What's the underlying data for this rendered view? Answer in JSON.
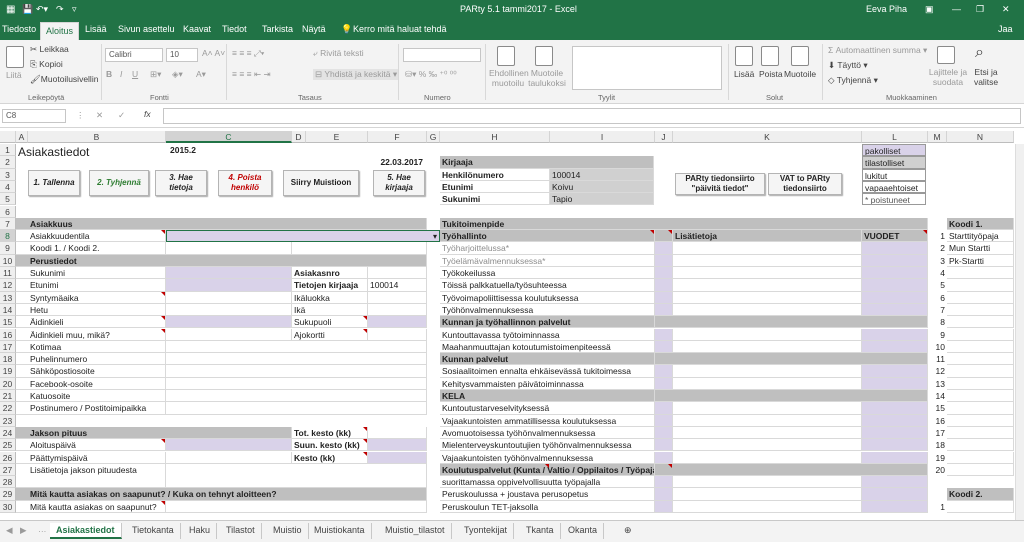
{
  "window": {
    "title": "PARty 5.1 tammi2017  -  Excel",
    "user": "Eeva Piha"
  },
  "menu": {
    "tabs": [
      "Tiedosto",
      "Aloitus",
      "Lisää",
      "Sivun asettelu",
      "Kaavat",
      "Tiedot",
      "Tarkista",
      "Näytä"
    ],
    "tell": "Kerro mitä haluat tehdä",
    "share": "Jaa"
  },
  "ribbon": {
    "paste": "Liitä",
    "cut": "Leikkaa",
    "copy": "Kopioi",
    "format_painter": "Muotoilusivellin",
    "clipboard": "Leikepöytä",
    "font_name": "Calibri",
    "font_size": "10",
    "font": "Fontti",
    "wrap": "Rivitä teksti",
    "merge": "Yhdistä ja keskitä",
    "alignment": "Tasaus",
    "number": "Numero",
    "cond_format": "Ehdollinen muotoilu",
    "table_format": "Muotoile taulukoksi",
    "styles": "Tyylit",
    "insert": "Lisää",
    "delete": "Poista",
    "format": "Muotoile",
    "cells": "Solut",
    "autosum": "Automaattinen summa",
    "fill": "Täyttö",
    "clear": "Tyhjennä",
    "sort": "Lajittele ja suodata",
    "find": "Etsi ja valitse",
    "editing": "Muokkaaminen"
  },
  "formula_bar": {
    "name_box": "C8",
    "fx": "fx",
    "value": ""
  },
  "columns": [
    "A",
    "B",
    "C",
    "D",
    "E",
    "F",
    "G",
    "H",
    "I",
    "J",
    "K",
    "L",
    "M",
    "N"
  ],
  "rows": [
    "1",
    "2",
    "3",
    "4",
    "5",
    "6",
    "7",
    "8",
    "9",
    "10",
    "11",
    "12",
    "13",
    "14",
    "15",
    "16",
    "17",
    "18",
    "19",
    "20",
    "21",
    "22",
    "23",
    "24",
    "25",
    "26",
    "27",
    "28",
    "29",
    "30"
  ],
  "sheet": {
    "title": "Asiakastiedot",
    "version": "2015.2",
    "date": "22.03.2017",
    "buttons": [
      "1. Tallenna",
      "2. Tyhjennä",
      "3. Hae\ntietoja",
      "4. Poista\nhenkilö",
      "Siirry Muistioon",
      "5. Hae\nkirjaaja"
    ],
    "party_buttons": [
      "PARty tiedonsiirto\n\"päivitä tiedot\"",
      "VAT to PARty\ntiedonsiirto"
    ],
    "kirjaaja": {
      "header": "Kirjaaja",
      "rows": [
        [
          "Henkilönumero",
          "100014"
        ],
        [
          "Etunimi",
          "Koivu"
        ],
        [
          "Sukunimi",
          "Tapio"
        ]
      ]
    },
    "legend": [
      "pakolliset",
      "tilastolliset",
      "lukitut",
      "vapaaehtoiset",
      "* poistuneet"
    ],
    "left": {
      "asiakkuus": "Asiakkuus",
      "asiakkuudentila": "Asiakkuudentila",
      "koodi12": "Koodi 1. / Koodi 2.",
      "perustiedot": "Perustiedot",
      "fields": [
        "Sukunimi",
        "Etunimi",
        "Syntymäaika",
        "Hetu",
        "Äidinkieli",
        "Äidinkieli muu, mikä?",
        "Kotimaa",
        "Puhelinnumero",
        "Sähköpostiosoite",
        "Facebook-osoite",
        "Katuosoite",
        "Postinumero / Postitoimipaikka"
      ],
      "right_labels": [
        "Asiakasnro",
        "Tietojen kirjaaja",
        "Ikäluokka",
        "Ikä",
        "Sukupuoli",
        "Ajokortti"
      ],
      "kirjaaja_value": "100014",
      "jakso": "Jakson pituus",
      "aloitus": "Aloituspäivä",
      "paattymis": "Päättymispäivä",
      "lisatietoja": "Lisätietoja jakson pituudesta",
      "tot": "Tot. kesto (kk)",
      "suun": "Suun. kesto (kk)",
      "kesto": "Kesto (kk)",
      "mita": "Mitä kautta asiakas on saapunut? / Kuka on tehnyt aloitteen?",
      "mita2": "Mitä kautta asiakas on saapunut?"
    },
    "middle": {
      "tukitoimenpide": "Tukitoimenpide",
      "tyohallinto": "Työhallinto",
      "lisatietoja": "Lisätietoja",
      "vuodet": "VUODET",
      "items": [
        {
          "t": "Työharjoittelussa*",
          "k": "gray"
        },
        {
          "t": "Työelämävalmennuksessa*",
          "k": "gray"
        },
        {
          "t": "Työkokeilussa",
          "k": "n"
        },
        {
          "t": "Töissä palkkatuella/työsuhteessa",
          "k": "n"
        },
        {
          "t": "Työvoimapoliittisessa koulutuksessa",
          "k": "n"
        },
        {
          "t": "Työhönvalmennuksessa",
          "k": "n"
        },
        {
          "t": "Kunnan ja työhallinnon palvelut",
          "k": "h"
        },
        {
          "t": "Kuntouttavassa työtoiminnassa",
          "k": "n"
        },
        {
          "t": "Maahanmuuttajan kotoutumistoimenpiteessä",
          "k": "n"
        },
        {
          "t": "Kunnan palvelut",
          "k": "h"
        },
        {
          "t": "Sosiaalitoimen ennalta ehkäisevässä tukitoimessa",
          "k": "n"
        },
        {
          "t": "Kehitysvammaisten päivätoiminnassa",
          "k": "n"
        },
        {
          "t": "KELA",
          "k": "h"
        },
        {
          "t": "Kuntoutustarveselvityksessä",
          "k": "n"
        },
        {
          "t": "Vajaakuntoisten ammatillisessa koulutuksessa",
          "k": "n"
        },
        {
          "t": "Avomuotoisessa työhönvalmennuksessa",
          "k": "n"
        },
        {
          "t": "Mielenterveyskuntoutujien työhönvalmennuksessa",
          "k": "n"
        },
        {
          "t": "Vajaakuntoisten työhönvalmennuksessa",
          "k": "n"
        },
        {
          "t": "Koulutuspalvelut (Kunta / Valtio / Oppilaitos / Työpaja)",
          "k": "h"
        },
        {
          "t": "suorittamassa oppivelvollisuutta työpajalla",
          "k": "n"
        },
        {
          "t": "Peruskoulussa + joustava perusopetus",
          "k": "n"
        },
        {
          "t": "Peruskoulun TET-jaksolla",
          "k": "n"
        }
      ]
    },
    "koodi1": {
      "header": "Koodi 1.",
      "items": [
        [
          "1",
          "Starttityöpaja"
        ],
        [
          "2",
          "Mun Startti"
        ],
        [
          "3",
          "Pk-Startti"
        ],
        [
          "4",
          ""
        ],
        [
          "5",
          ""
        ],
        [
          "6",
          ""
        ],
        [
          "7",
          ""
        ],
        [
          "8",
          ""
        ],
        [
          "9",
          ""
        ],
        [
          "10",
          ""
        ],
        [
          "11",
          ""
        ],
        [
          "12",
          ""
        ],
        [
          "13",
          ""
        ],
        [
          "14",
          ""
        ],
        [
          "15",
          ""
        ],
        [
          "16",
          ""
        ],
        [
          "17",
          ""
        ],
        [
          "18",
          ""
        ],
        [
          "19",
          ""
        ],
        [
          "20",
          ""
        ]
      ]
    },
    "koodi2": {
      "header": "Koodi 2.",
      "items": [
        [
          "1",
          ""
        ]
      ]
    }
  },
  "sheet_tabs": [
    "Asiakastiedot",
    "Tietokanta",
    "Haku",
    "Tilastot",
    "Muistio",
    "Muistiokanta",
    "Muistio_tilastot",
    "Tyontekijat",
    "Tkanta",
    "Okanta"
  ]
}
